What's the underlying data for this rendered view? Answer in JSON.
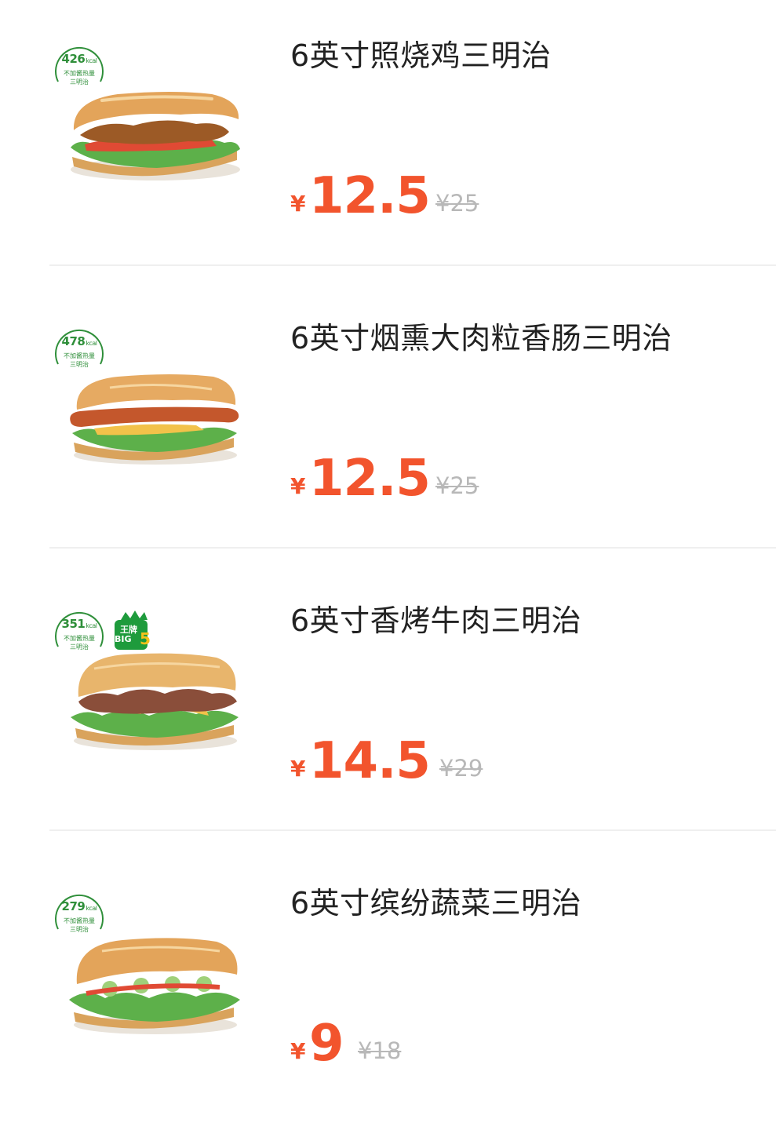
{
  "colors": {
    "price": "#f2542d",
    "original_price": "#b8b8b8",
    "kcal_badge": "#2f8f3a",
    "title": "#222222"
  },
  "kcal_labels": {
    "unit": "kcal",
    "line1": "不加酱热量",
    "line2": "三明治"
  },
  "badge": {
    "line1": "王牌",
    "line2": "BIG",
    "number": "5"
  },
  "products": [
    {
      "name": "6英寸照烧鸡三明治",
      "kcal": "426",
      "currency": "¥",
      "price": "12.5",
      "original_price": "¥25",
      "image_icon": "teriyaki-chicken-sandwich-image"
    },
    {
      "name": "6英寸烟熏大肉粒香肠三明治",
      "kcal": "478",
      "currency": "¥",
      "price": "12.5",
      "original_price": "¥25",
      "image_icon": "smoked-sausage-sandwich-image"
    },
    {
      "name": "6英寸香烤牛肉三明治",
      "kcal": "351",
      "currency": "¥",
      "price": "14.5",
      "original_price": "¥29",
      "image_icon": "roast-beef-sandwich-image",
      "has_big5_badge": true
    },
    {
      "name": "6英寸缤纷蔬菜三明治",
      "kcal": "279",
      "currency": "¥",
      "price": "9",
      "original_price": "¥18",
      "image_icon": "veggie-sandwich-image"
    }
  ]
}
